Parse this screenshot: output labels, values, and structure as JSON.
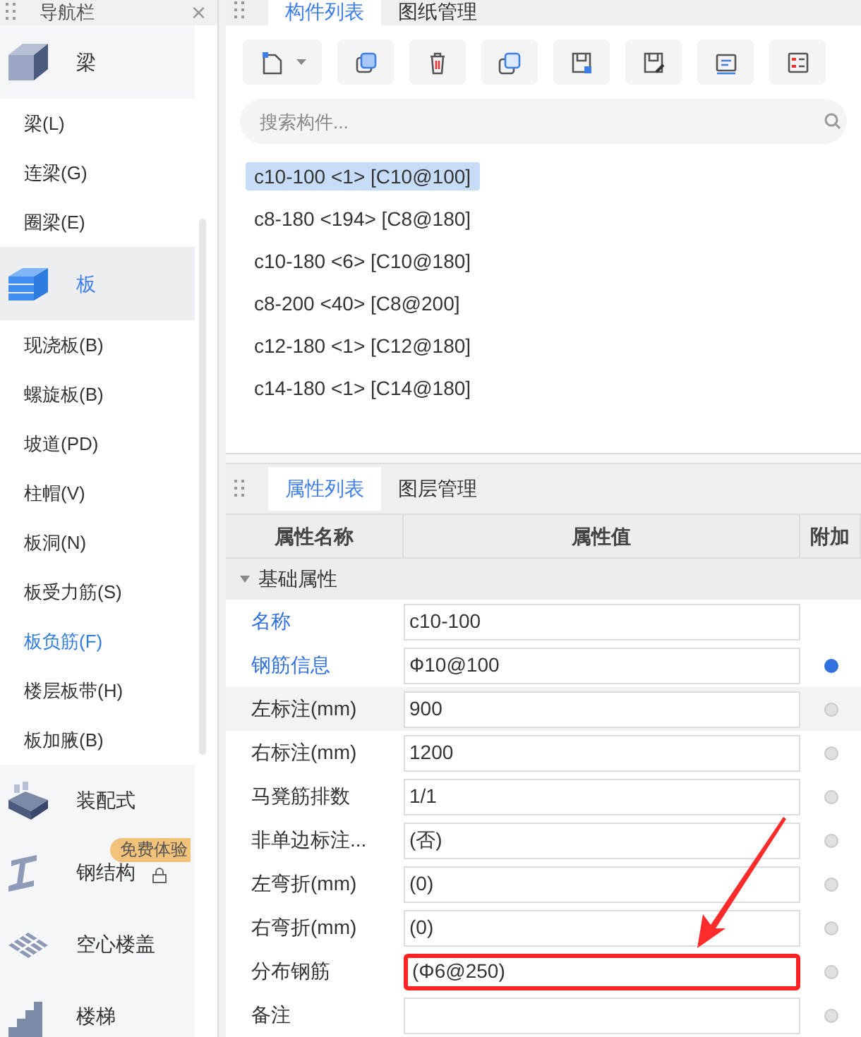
{
  "nav": {
    "title": "导航栏",
    "close": "×",
    "groups": [
      {
        "label": "梁",
        "selected": false,
        "items": [
          {
            "label": "梁(L)",
            "selected": false
          },
          {
            "label": "连梁(G)",
            "selected": false
          },
          {
            "label": "圈梁(E)",
            "selected": false
          }
        ]
      },
      {
        "label": "板",
        "selected": true,
        "items": [
          {
            "label": "现浇板(B)",
            "selected": false
          },
          {
            "label": "螺旋板(B)",
            "selected": false
          },
          {
            "label": "坡道(PD)",
            "selected": false
          },
          {
            "label": "柱帽(V)",
            "selected": false
          },
          {
            "label": "板洞(N)",
            "selected": false
          },
          {
            "label": "板受力筋(S)",
            "selected": false
          },
          {
            "label": "板负筋(F)",
            "selected": true
          },
          {
            "label": "楼层板带(H)",
            "selected": false
          },
          {
            "label": "板加腋(B)",
            "selected": false
          }
        ]
      },
      {
        "label": "装配式",
        "selected": false
      },
      {
        "label": "钢结构",
        "selected": false,
        "badge": "免费体验",
        "locked": true
      },
      {
        "label": "空心楼盖",
        "selected": false
      },
      {
        "label": "楼梯",
        "selected": false
      }
    ]
  },
  "component_panel": {
    "tabs": [
      {
        "label": "构件列表",
        "selected": true
      },
      {
        "label": "图纸管理",
        "selected": false
      }
    ],
    "search": {
      "placeholder": "搜索构件..."
    },
    "components": [
      {
        "label": "c10-100 <1> [C10@100]",
        "selected": true
      },
      {
        "label": "c8-180 <194> [C8@180]",
        "selected": false
      },
      {
        "label": "c10-180 <6> [C10@180]",
        "selected": false
      },
      {
        "label": "c8-200 <40> [C8@200]",
        "selected": false
      },
      {
        "label": "c12-180 <1> [C12@180]",
        "selected": false
      },
      {
        "label": "c14-180 <1> [C14@180]",
        "selected": false
      }
    ]
  },
  "property_panel": {
    "tabs": [
      {
        "label": "属性列表",
        "selected": true
      },
      {
        "label": "图层管理",
        "selected": false
      }
    ],
    "columns": [
      "属性名称",
      "属性值",
      "附加"
    ],
    "group": {
      "label": "基础属性",
      "expanded": true
    },
    "rows": [
      {
        "name": "名称",
        "value": "c10-100",
        "emphasis": true,
        "highlighted": false,
        "selected": false
      },
      {
        "name": "钢筋信息",
        "value": "Ф10@100",
        "emphasis": true,
        "attached": true,
        "highlighted": false,
        "selected": false
      },
      {
        "name": "左标注(mm)",
        "value": "900",
        "emphasis": false,
        "attached": false,
        "highlighted": true,
        "selected": false
      },
      {
        "name": "右标注(mm)",
        "value": "1200",
        "emphasis": false,
        "attached": false,
        "highlighted": false,
        "selected": false
      },
      {
        "name": "马凳筋排数",
        "value": "1/1",
        "emphasis": false,
        "attached": false,
        "highlighted": false,
        "selected": false
      },
      {
        "name": "非单边标注...",
        "value": "(否)",
        "emphasis": false,
        "attached": false,
        "highlighted": false,
        "selected": false
      },
      {
        "name": "左弯折(mm)",
        "value": "(0)",
        "emphasis": false,
        "attached": false,
        "highlighted": false,
        "selected": false
      },
      {
        "name": "右弯折(mm)",
        "value": "(0)",
        "emphasis": false,
        "attached": false,
        "highlighted": false,
        "selected": false
      },
      {
        "name": "分布钢筋",
        "value": "(Φ6@250)",
        "emphasis": false,
        "attached": false,
        "highlighted": false,
        "selected": true
      },
      {
        "name": "备注",
        "emphasis": false,
        "attached": false,
        "highlighted": false,
        "selected": false
      }
    ]
  }
}
